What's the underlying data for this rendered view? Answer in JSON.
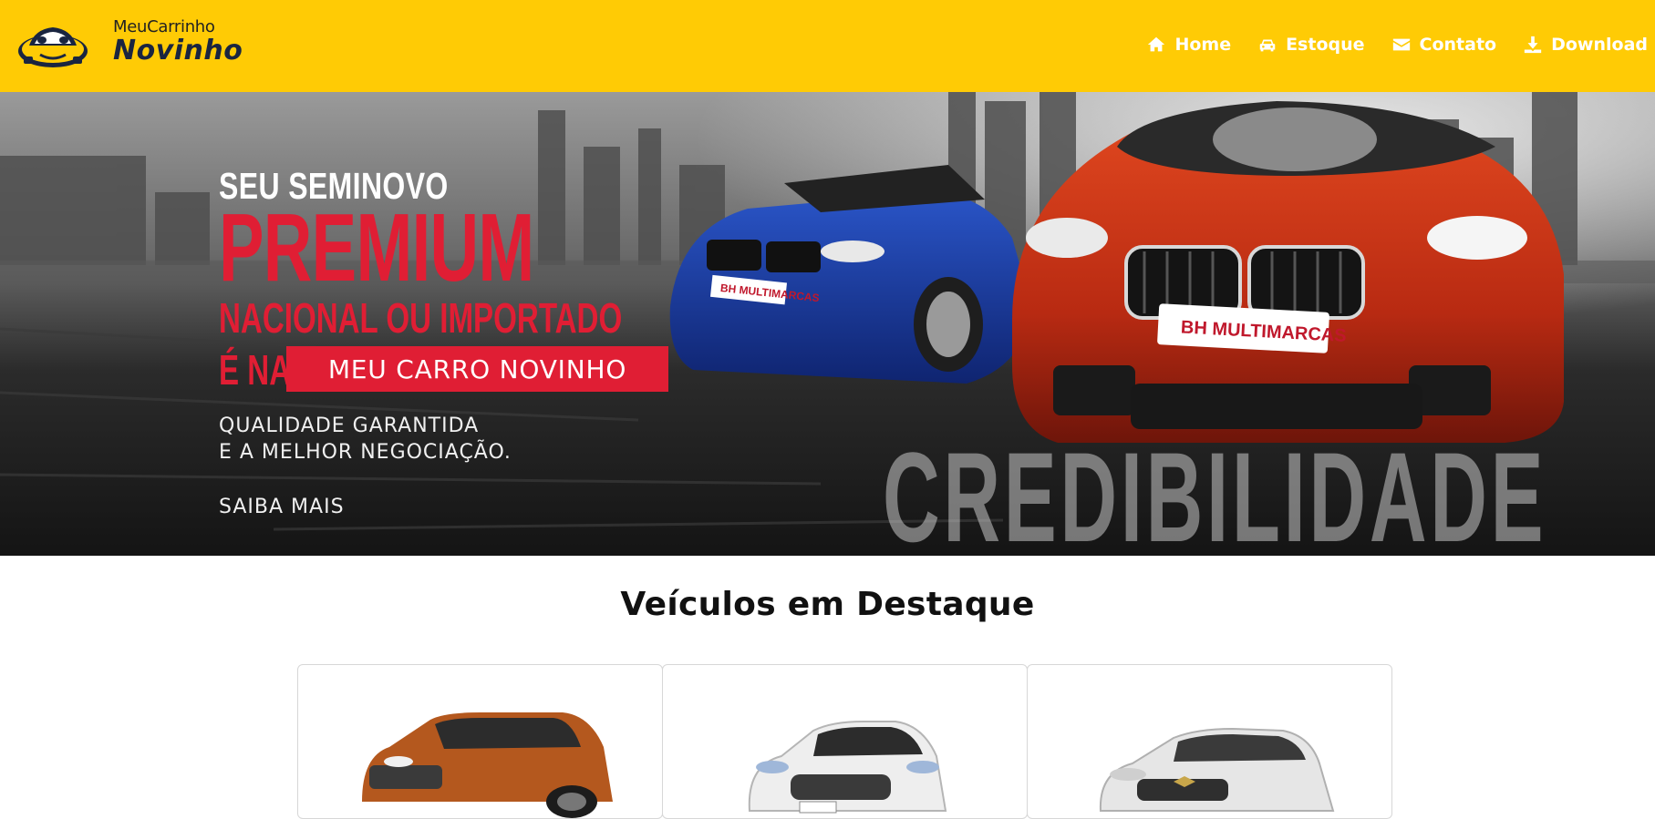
{
  "brand": {
    "small": "MeuCarrinho",
    "big": "Novinho",
    "colors": {
      "navbar": "#ffcb05",
      "accent": "#e01e34"
    }
  },
  "nav": {
    "items": [
      {
        "label": "Home",
        "icon": "home-icon"
      },
      {
        "label": "Estoque",
        "icon": "car-icon"
      },
      {
        "label": "Contato",
        "icon": "envelope-icon"
      },
      {
        "label": "Download",
        "icon": "download-icon"
      }
    ]
  },
  "hero": {
    "line1": "SEU SEMINOVO",
    "line2": "PREMIUM",
    "line3": "NACIONAL OU IMPORTADO",
    "line4": "É NA",
    "badge": "MEU CARRO NOVINHO",
    "tagline1": "QUALIDADE GARANTIDA",
    "tagline2": "E A MELHOR NEGOCIAÇÃO.",
    "cta": "SAIBA MAIS",
    "watermark": "CREDIBILIDADE",
    "plate_blue": "BH MULTIMARCAS",
    "plate_red": "BH MULTIMARCAS"
  },
  "featured": {
    "title": "Veículos em Destaque",
    "cards": [
      {
        "color": "#b4581e"
      },
      {
        "color": "#eeeeee"
      },
      {
        "color": "#e6e6e6"
      }
    ]
  }
}
